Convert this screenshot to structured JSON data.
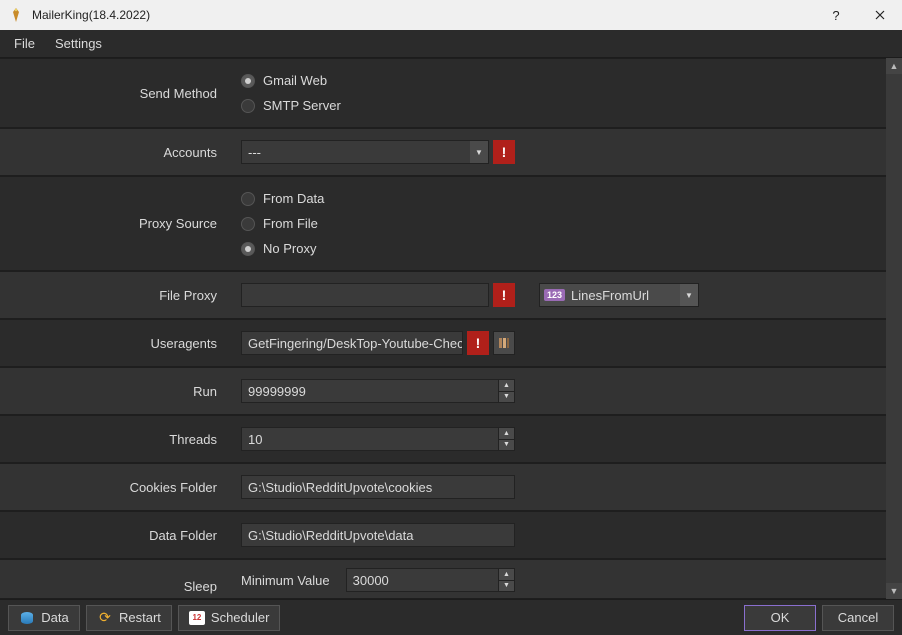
{
  "window": {
    "title": "MailerKing(18.4.2022)"
  },
  "menu": {
    "file": "File",
    "settings": "Settings"
  },
  "rows": {
    "send_method": {
      "label": "Send Method",
      "opt_gmail": "Gmail Web",
      "opt_smtp": "SMTP Server"
    },
    "accounts": {
      "label": "Accounts",
      "value": "---"
    },
    "proxy_source": {
      "label": "Proxy Source",
      "opt_data": "From Data",
      "opt_file": "From File",
      "opt_none": "No Proxy"
    },
    "file_proxy": {
      "label": "File Proxy",
      "value": "",
      "url_badge": "123",
      "url_label": "LinesFromUrl"
    },
    "useragents": {
      "label": "Useragents",
      "value": "GetFingering/DeskTop-Youtube-Checked."
    },
    "run": {
      "label": "Run",
      "value": "99999999"
    },
    "threads": {
      "label": "Threads",
      "value": "10"
    },
    "cookies_folder": {
      "label": "Cookies Folder",
      "value": "G:\\Studio\\RedditUpvote\\cookies"
    },
    "data_folder": {
      "label": "Data Folder",
      "value": "G:\\Studio\\RedditUpvote\\data"
    },
    "sleep": {
      "label": "Sleep",
      "sub": "Minimum Value",
      "value": "30000"
    }
  },
  "footer": {
    "data": "Data",
    "restart": "Restart",
    "scheduler": "Scheduler",
    "scheduler_day": "12",
    "ok": "OK",
    "cancel": "Cancel"
  }
}
